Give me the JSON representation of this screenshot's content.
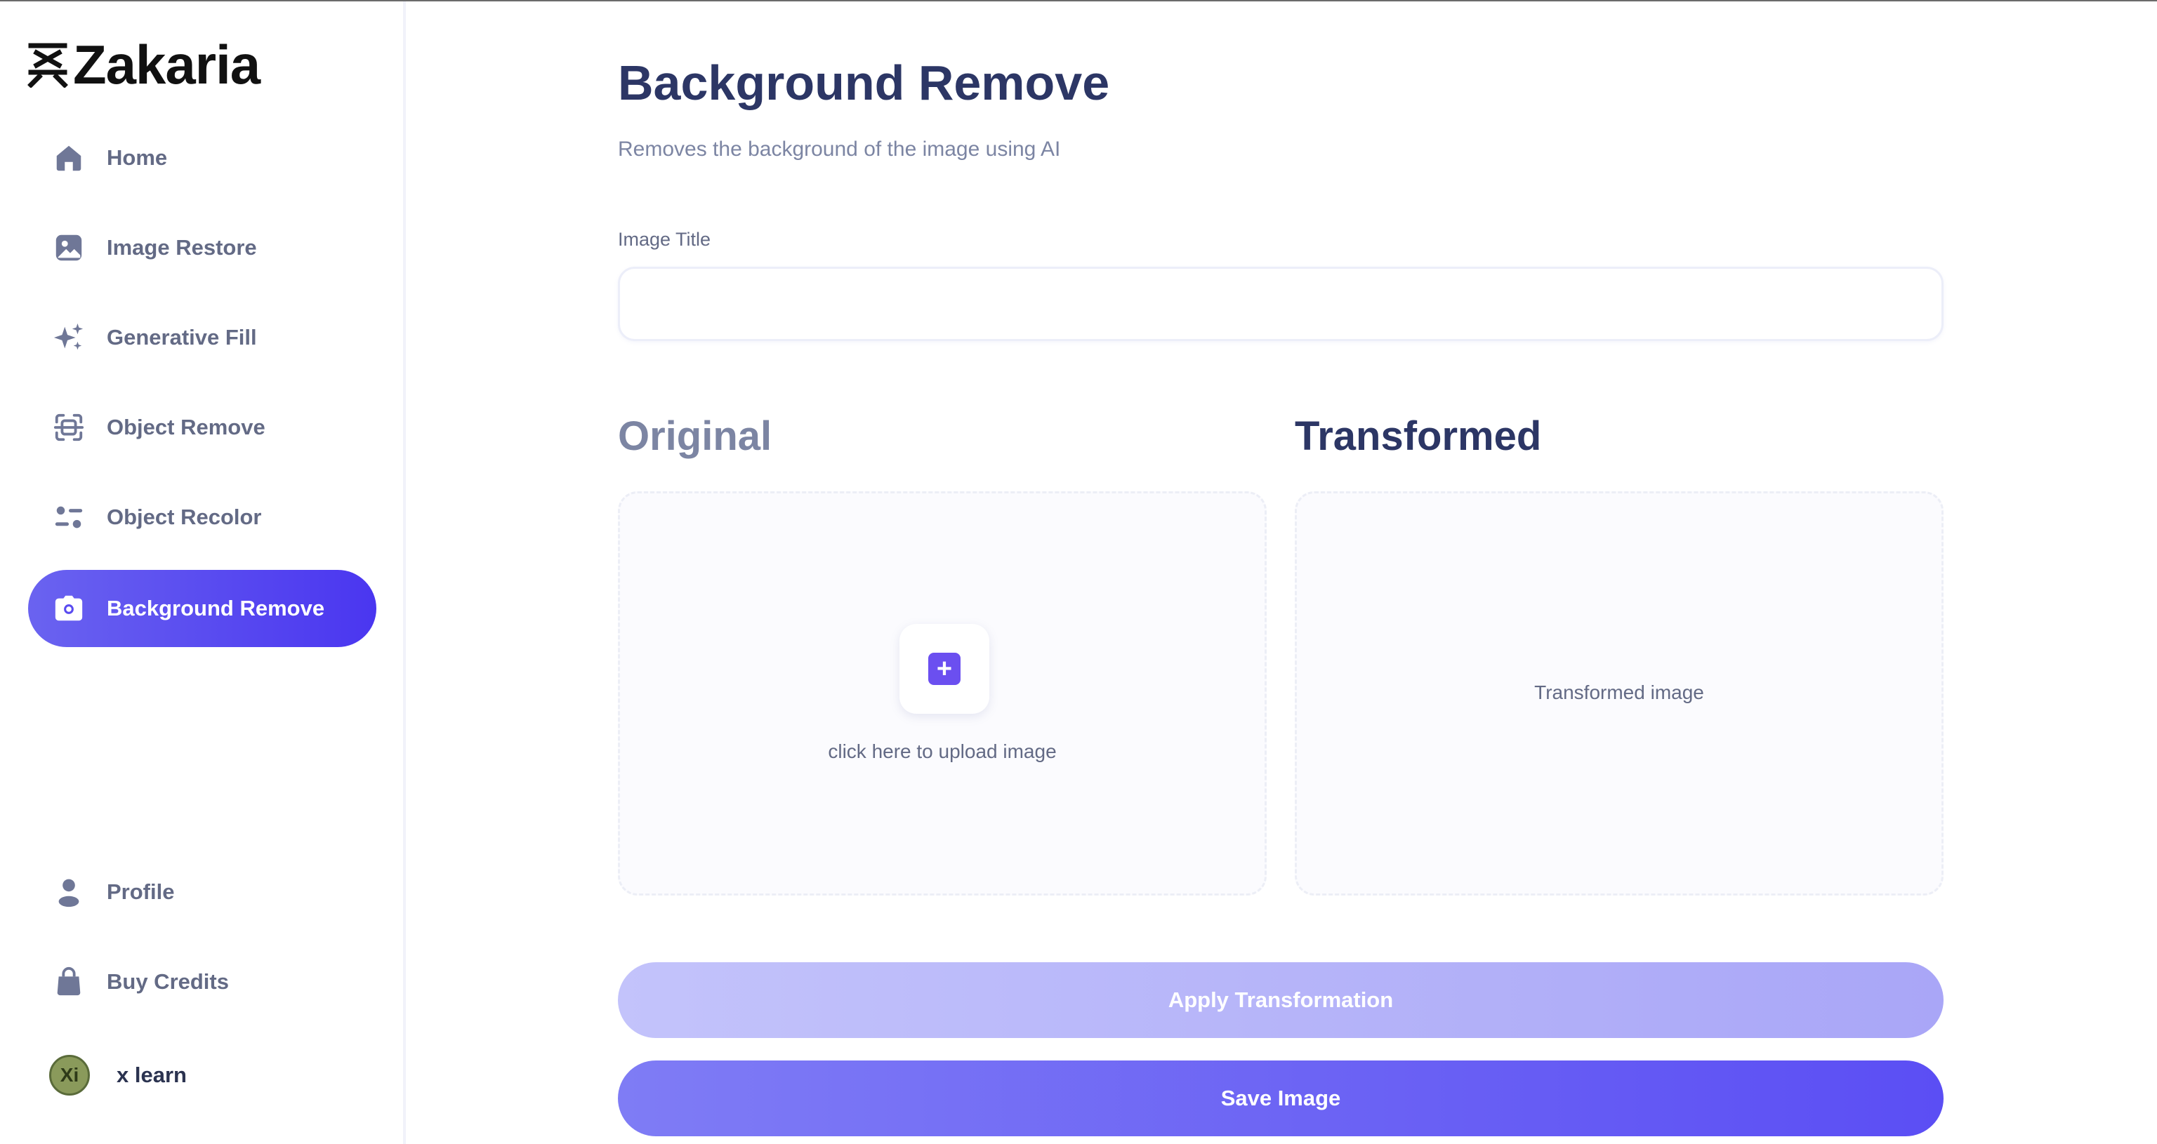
{
  "app": {
    "brand": "Zakaria"
  },
  "sidebar": {
    "items": [
      {
        "label": "Home",
        "icon": "home-icon"
      },
      {
        "label": "Image Restore",
        "icon": "image-icon"
      },
      {
        "label": "Generative Fill",
        "icon": "sparkles-icon"
      },
      {
        "label": "Object Remove",
        "icon": "scan-icon"
      },
      {
        "label": "Object Recolor",
        "icon": "filter-icon"
      },
      {
        "label": "Background Remove",
        "icon": "camera-icon",
        "active": true
      }
    ],
    "bottom": [
      {
        "label": "Profile",
        "icon": "user-icon"
      },
      {
        "label": "Buy Credits",
        "icon": "bag-icon"
      }
    ],
    "user": {
      "name": "x learn",
      "initials": "Xi"
    }
  },
  "main": {
    "title": "Background Remove",
    "subtitle": "Removes the background of the image using AI",
    "image_title_label": "Image Title",
    "image_title_value": "",
    "original_heading": "Original",
    "transformed_heading": "Transformed",
    "upload_text": "click here to upload image",
    "upload_icon": "+",
    "transformed_placeholder": "Transformed image",
    "apply_button": "Apply Transformation",
    "save_button": "Save Image"
  },
  "colors": {
    "accent": "#4a36f0",
    "heading": "#2c3665",
    "muted": "#7c85a3",
    "apply_disabled": "#b6b4f9",
    "save": "#5b4ef4"
  }
}
